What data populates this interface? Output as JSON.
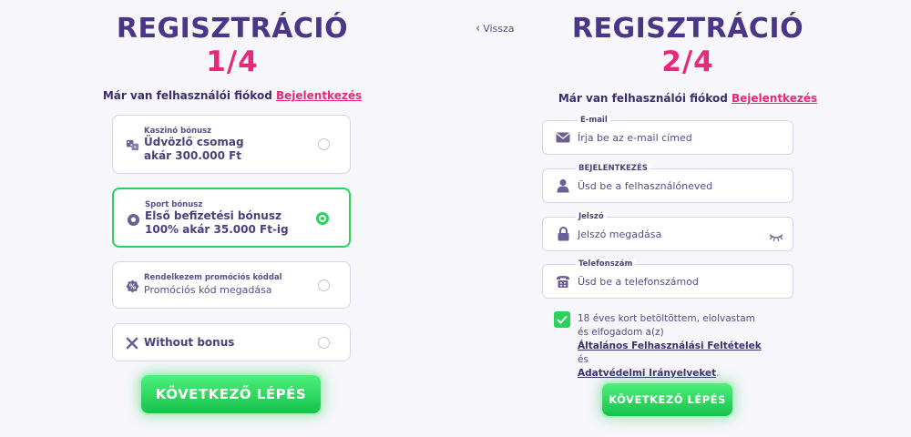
{
  "left": {
    "title": "REGISZTRÁCIÓ",
    "step": "1/4",
    "login_prompt": "Már van felhasználói fiókod",
    "login_link": "Bejelentkezés",
    "bonuses": [
      {
        "kicker": "Kaszinó bónusz",
        "line1": "Üdvözlő csomag",
        "line2": "akár 300.000 Ft",
        "icon": "dice-icon",
        "selected": false
      },
      {
        "kicker": "Sport bónusz",
        "line1": "Első befizetési bónusz",
        "line2": "100% akár 35.000 Ft-ig",
        "icon": "soccer-ball-icon",
        "selected": true
      },
      {
        "kicker": "Rendelkezem promóciós kóddal",
        "line1": "Promóciós kód megadása",
        "icon": "promo-badge-icon",
        "selected": false
      },
      {
        "line1": "Without bonus",
        "icon": "x-icon",
        "selected": false
      }
    ],
    "next_button": "KÖVETKEZŐ LÉPÉS"
  },
  "right": {
    "back_link": "Vissza",
    "title": "REGISZTRÁCIÓ",
    "step": "2/4",
    "login_prompt": "Már van felhasználói fiókod",
    "login_link": "Bejelentkezés",
    "fields": {
      "email": {
        "label": "E-mail",
        "placeholder": "Írja be az e-mail címed",
        "icon": "envelope-icon"
      },
      "username": {
        "label": "BEJELENTKEZÉS",
        "placeholder": "Üsd be a felhasználóneved",
        "icon": "user-icon"
      },
      "password": {
        "label": "Jelszó",
        "placeholder": "Jelszó megadása",
        "icon": "lock-icon"
      },
      "phone": {
        "label": "Telefonszám",
        "placeholder": "Üsd be a telefonszámod",
        "icon": "telephone-icon"
      }
    },
    "terms": {
      "checked": true,
      "text1": "18 éves kort betöltöttem, elolvastam és elfogadom a(z)",
      "link1": "Általános Felhasználási Feltételek",
      "and": "és",
      "link2": "Adatvédelmi Irányelveket",
      "end": "."
    },
    "next_button": "KÖVETKEZŐ LÉPÉS"
  },
  "colors": {
    "purple": "#4b3586",
    "pink": "#e8297b",
    "green": "#2bd25a",
    "border": "#d9d2ec"
  }
}
